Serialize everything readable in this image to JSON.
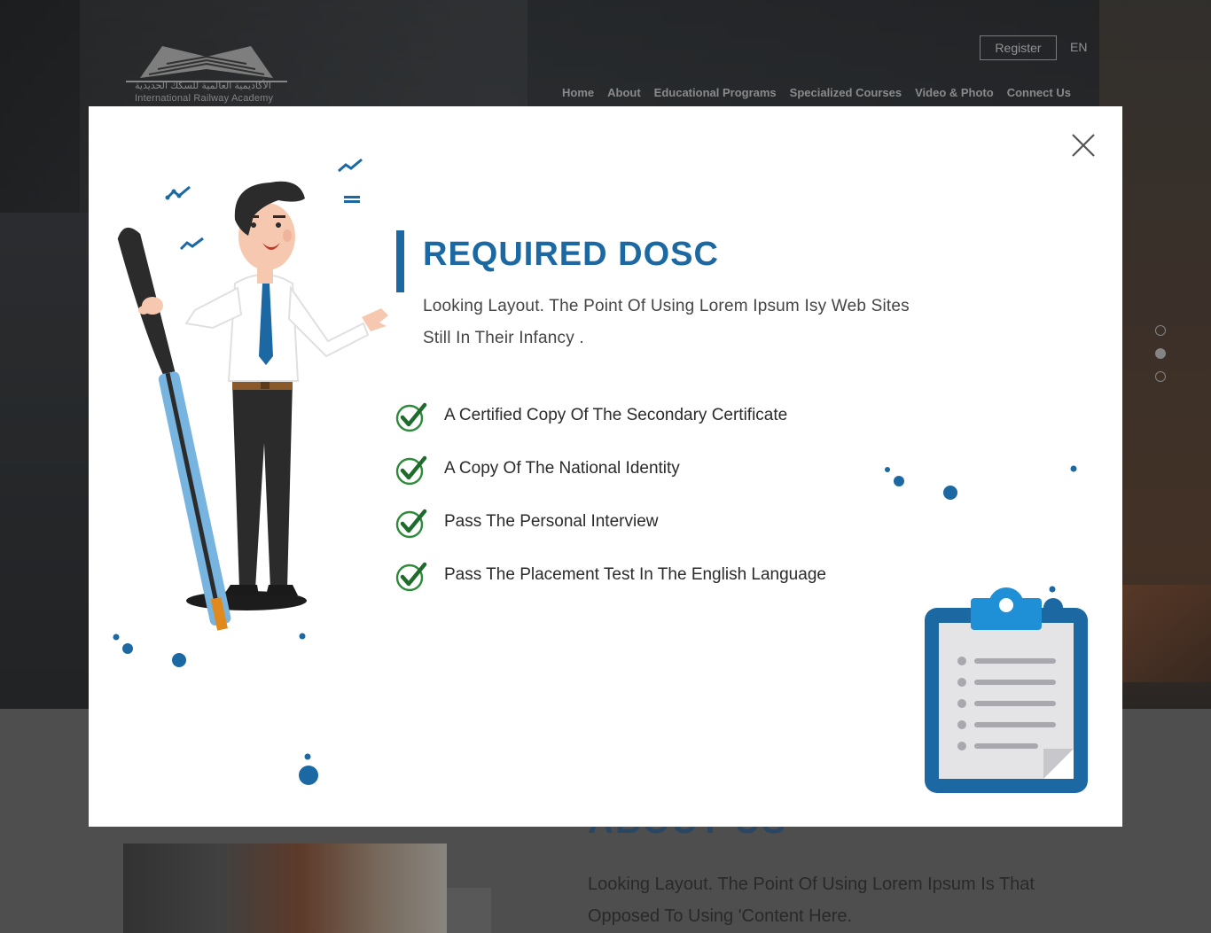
{
  "header": {
    "logo_arabic": "الأكاديمية العالمية للسكك الحديدية",
    "logo_english": "International Railway Academy",
    "register_label": "Register",
    "language_label": "EN",
    "nav": [
      "Home",
      "About",
      "Educational Programs",
      "Specialized Courses",
      "Video & Photo",
      "Connect Us"
    ]
  },
  "slider": {
    "dots": 3,
    "active_index": 1
  },
  "about": {
    "title": "ABOUT US",
    "text": "Looking Layout. The Point Of Using Lorem Ipsum Is That  Opposed To Using 'Content Here."
  },
  "modal": {
    "title": "REQUIRED DOSC",
    "subtitle": "Looking Layout. The Point Of Using Lorem Ipsum Isy Web Sites Still In Their Infancy .",
    "requirements": [
      "A Certified Copy Of The Secondary Certificate",
      "A Copy Of The National Identity",
      "Pass The Personal Interview",
      "Pass The Placement Test In The English Language"
    ],
    "icons": {
      "close": "close-icon",
      "check": "check-icon",
      "clipboard": "clipboard-icon"
    }
  },
  "colors": {
    "accent": "#1b68a3",
    "check": "#2e8b3a",
    "overlay": "#282828"
  }
}
